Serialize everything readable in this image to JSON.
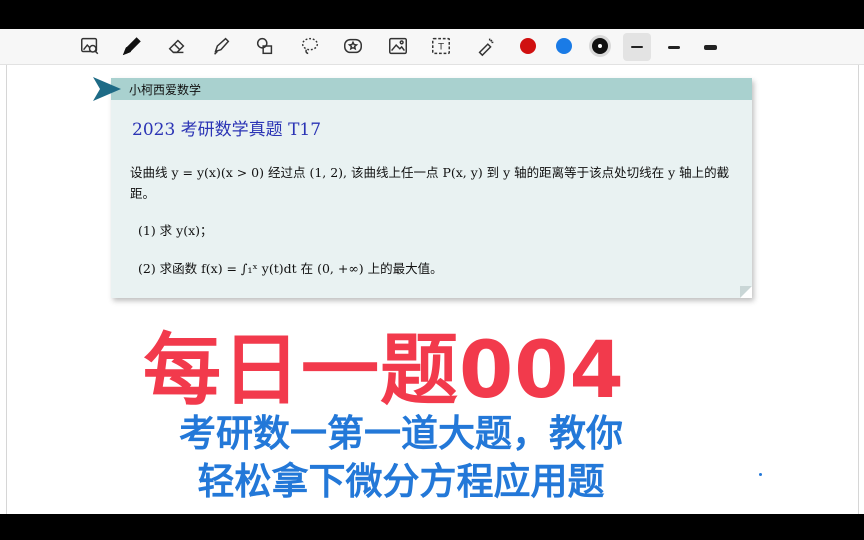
{
  "toolbar": {
    "tools": [
      {
        "icon": "image-search-icon"
      },
      {
        "icon": "pen-icon"
      },
      {
        "icon": "eraser-icon"
      },
      {
        "icon": "highlighter-icon"
      },
      {
        "icon": "shapes-icon"
      },
      {
        "icon": "lasso-icon"
      },
      {
        "icon": "sticker-icon"
      },
      {
        "icon": "image-icon"
      },
      {
        "icon": "text-box-icon"
      },
      {
        "icon": "laser-pointer-icon"
      }
    ],
    "colors": [
      "#d01010",
      "#1a7be6",
      "#111111"
    ],
    "text_tool_letter": "T"
  },
  "card": {
    "brand": "小柯西爱数学",
    "title": "2023 考研数学真题 T17",
    "problem_text": "设曲线 y = y(x)(x > 0) 经过点 (1, 2), 该曲线上任一点 P(x, y) 到 y 轴的距离等于该点处切线在 y 轴上的截距。",
    "part1": "(1) 求 y(x)；",
    "part2": "(2) 求函数 f(x) = ∫₁ˣ y(t)dt 在 (0, +∞) 上的最大值。"
  },
  "overlay": {
    "title": "每日一题004",
    "subtitle_line1": "考研数一第一道大题，教你",
    "subtitle_line2": "轻松拿下微分方程应用题"
  },
  "colors": {
    "title_red": "#f23a4c",
    "subtitle_blue": "#2378d8",
    "card_header": "#a9d1cf",
    "card_title_blue": "#2b34b5"
  }
}
